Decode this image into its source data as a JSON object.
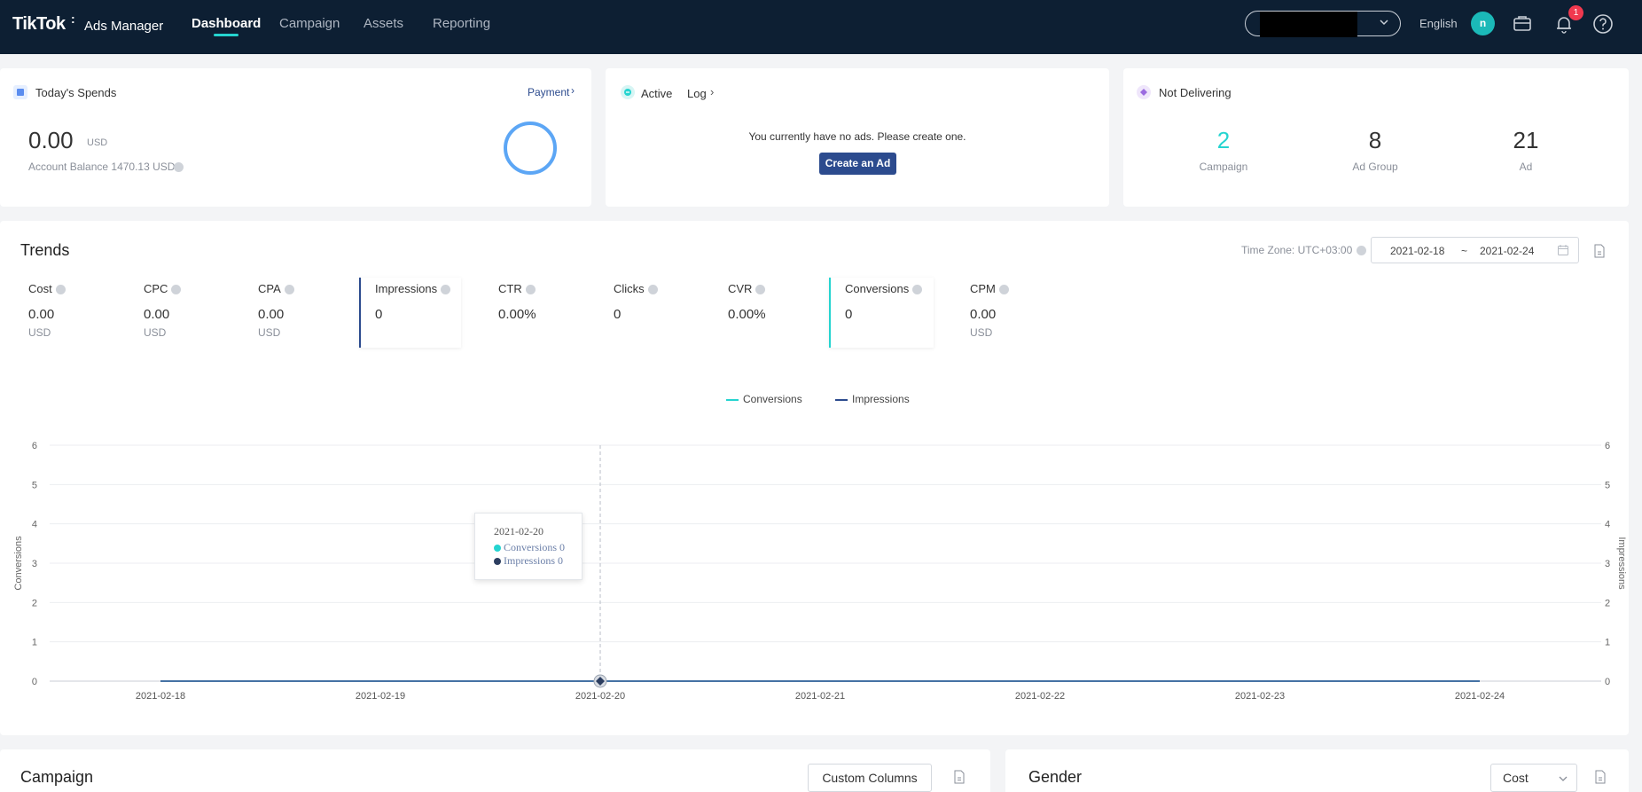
{
  "brand": {
    "name": "TikTok",
    "suffix": "Ads Manager"
  },
  "nav": {
    "dashboard": "Dashboard",
    "campaign": "Campaign",
    "assets": "Assets",
    "reporting": "Reporting"
  },
  "header": {
    "language": "English",
    "avatar_initial": "n",
    "notification_count": "1"
  },
  "spends_card": {
    "title": "Today's Spends",
    "payment_link": "Payment",
    "amount": "0.00",
    "currency": "USD",
    "balance_label": "Account Balance 1470.13 USD"
  },
  "active_card": {
    "tab_active": "Active",
    "tab_log": "Log",
    "empty_message": "You currently have no ads. Please create one.",
    "create_button": "Create an Ad"
  },
  "not_delivering_card": {
    "title": "Not Delivering",
    "campaign_value": "2",
    "campaign_label": "Campaign",
    "ad_group_value": "8",
    "ad_group_label": "Ad Group",
    "ad_value": "21",
    "ad_label": "Ad"
  },
  "trends": {
    "title": "Trends",
    "timezone": "Time Zone: UTC+03:00",
    "date_start": "2021-02-18",
    "date_sep": "~",
    "date_end": "2021-02-24",
    "metrics": {
      "cost": {
        "label": "Cost",
        "value": "0.00",
        "unit": "USD"
      },
      "cpc": {
        "label": "CPC",
        "value": "0.00",
        "unit": "USD"
      },
      "cpa": {
        "label": "CPA",
        "value": "0.00",
        "unit": "USD"
      },
      "impressions": {
        "label": "Impressions",
        "value": "0"
      },
      "ctr": {
        "label": "CTR",
        "value": "0.00%"
      },
      "clicks": {
        "label": "Clicks",
        "value": "0"
      },
      "cvr": {
        "label": "CVR",
        "value": "0.00%"
      },
      "conversions": {
        "label": "Conversions",
        "value": "0"
      },
      "cpm": {
        "label": "CPM",
        "value": "0.00",
        "unit": "USD"
      }
    }
  },
  "chart_data": {
    "type": "line",
    "x": [
      "2021-02-18",
      "2021-02-19",
      "2021-02-20",
      "2021-02-21",
      "2021-02-22",
      "2021-02-23",
      "2021-02-24"
    ],
    "series": [
      {
        "name": "Conversions",
        "values": [
          0,
          0,
          0,
          0,
          0,
          0,
          0
        ],
        "color": "#25d4d0"
      },
      {
        "name": "Impressions",
        "values": [
          0,
          0,
          0,
          0,
          0,
          0,
          0
        ],
        "color": "#2c4b8e"
      }
    ],
    "ylabel": "Conversions",
    "y2label": "Impressions",
    "ylim": [
      0,
      6
    ],
    "yticks": [
      0,
      1,
      2,
      3,
      4,
      5,
      6
    ],
    "legend": "top-center",
    "grid": true,
    "tooltip": {
      "date": "2021-02-20",
      "lines": [
        "Conversions 0",
        "Impressions 0"
      ]
    }
  },
  "campaign_section": {
    "title": "Campaign",
    "custom_columns": "Custom Columns"
  },
  "gender_section": {
    "title": "Gender",
    "metric_select": "Cost"
  }
}
